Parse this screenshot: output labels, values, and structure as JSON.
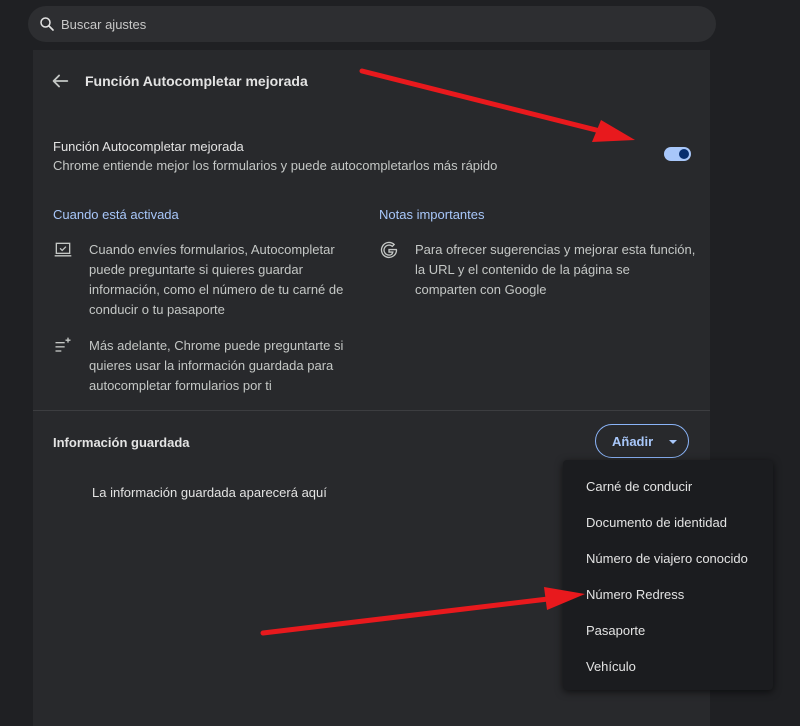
{
  "search": {
    "placeholder": "Buscar ajustes"
  },
  "header": {
    "title": "Función Autocompletar mejorada"
  },
  "setting": {
    "title": "Función Autocompletar mejorada",
    "description": "Chrome entiende mejor los formularios y puede autocompletarlos más rápido",
    "enabled": true
  },
  "when_active": {
    "heading": "Cuando está activada",
    "items": [
      {
        "icon": "laptop-check-icon",
        "lines": [
          "Cuando envíes formularios, Autocompletar",
          "puede preguntarte si quieres guardar",
          "información, como el número de tu carné de",
          "conducir o tu pasaporte"
        ]
      },
      {
        "icon": "list-sparkle-icon",
        "lines": [
          "Más adelante, Chrome puede preguntarte si",
          "quieres usar la información guardada para",
          "autocompletar formularios por ti"
        ]
      }
    ]
  },
  "notes": {
    "heading": "Notas importantes",
    "items": [
      {
        "icon": "google-g-icon",
        "lines": [
          "Para ofrecer sugerencias y mejorar esta función,",
          "la URL y el contenido de la página se",
          "comparten con Google"
        ]
      }
    ]
  },
  "saved": {
    "title": "Información guardada",
    "add_label": "Añadir",
    "empty_message": "La información guardada aparecerá aquí"
  },
  "menu": {
    "items": [
      "Carné de conducir",
      "Documento de identidad",
      "Número de viajero conocido",
      "Número Redress",
      "Pasaporte",
      "Vehículo"
    ]
  },
  "colors": {
    "accent": "#a8c7fa",
    "annotation_arrow": "#e8191d"
  }
}
